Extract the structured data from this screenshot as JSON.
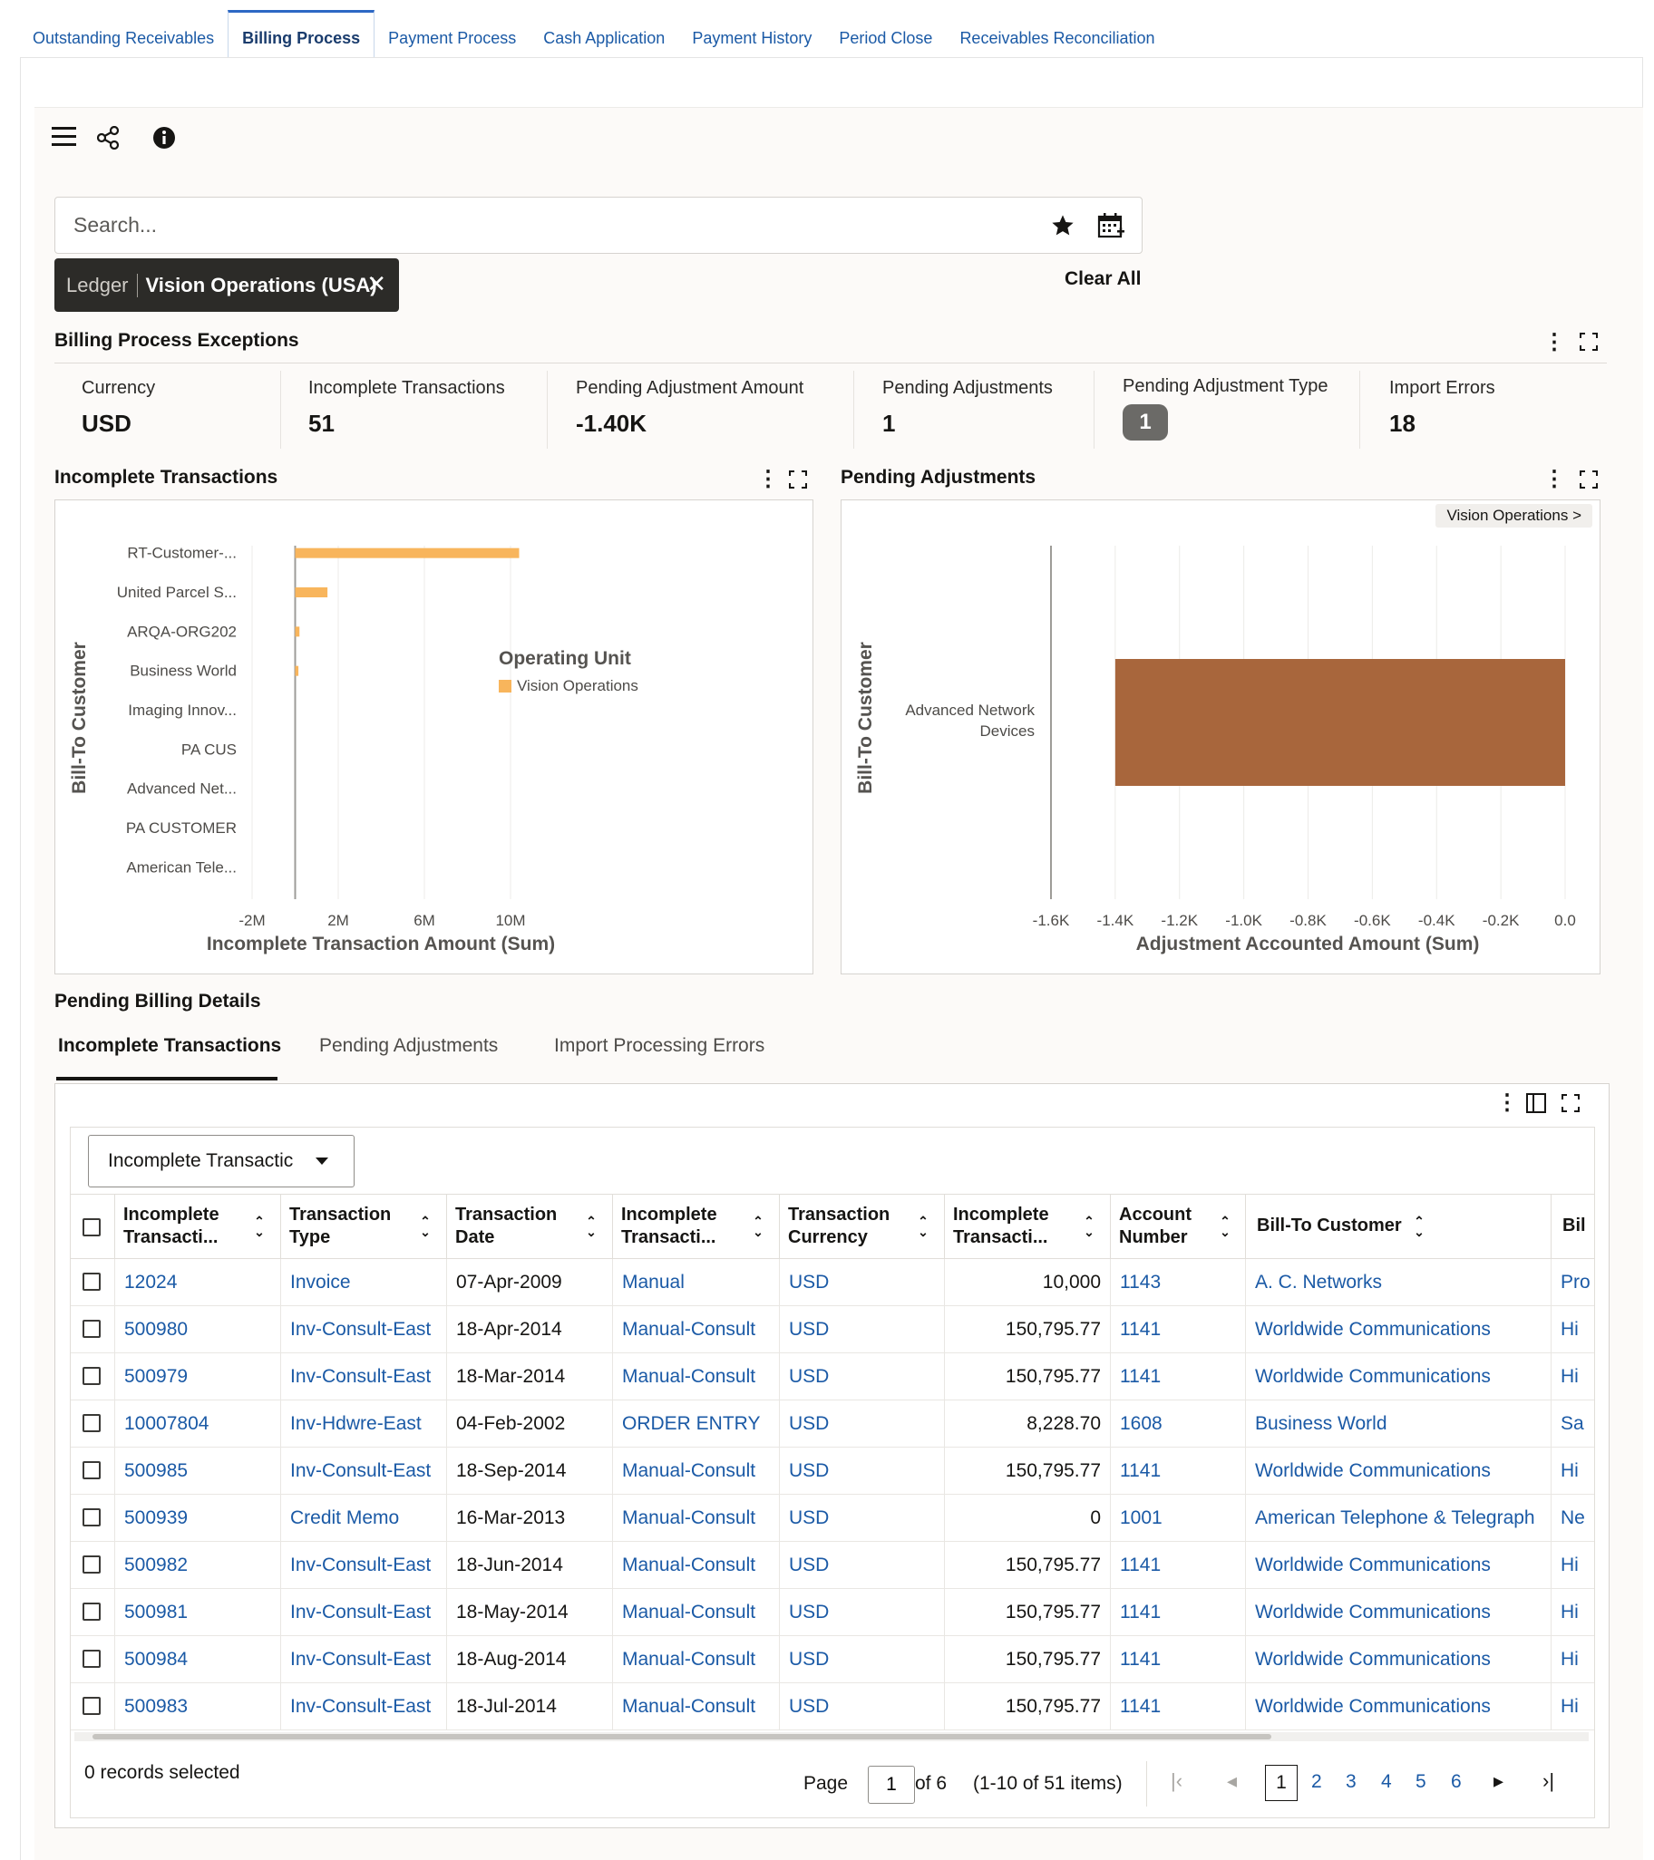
{
  "top_tabs": [
    {
      "label": "Outstanding Receivables"
    },
    {
      "label": "Billing Process"
    },
    {
      "label": "Payment Process"
    },
    {
      "label": "Cash Application"
    },
    {
      "label": "Payment History"
    },
    {
      "label": "Period Close"
    },
    {
      "label": "Receivables Reconciliation"
    }
  ],
  "active_tab": "Billing Process",
  "toolbar": {
    "menu_icon": "hamburger-icon",
    "share_icon": "share-icon",
    "info_icon": "info-icon"
  },
  "search": {
    "placeholder": "Search...",
    "value": "",
    "star_icon": "star-icon",
    "calendar_icon": "calendar-icon"
  },
  "filter_chip": {
    "label": "Ledger",
    "value": "Vision Operations (USA)"
  },
  "clear_all": "Clear All",
  "exceptions": {
    "title": "Billing Process Exceptions",
    "metrics": [
      {
        "label": "Currency",
        "value": "USD"
      },
      {
        "label": "Incomplete Transactions",
        "value": "51"
      },
      {
        "label": "Pending Adjustment Amount",
        "value": "-1.40K"
      },
      {
        "label": "Pending Adjustments",
        "value": "1"
      },
      {
        "label": "Pending Adjustment Type",
        "value": "1"
      },
      {
        "label": "Import Errors",
        "value": "18"
      }
    ]
  },
  "chart_incomplete": {
    "title": "Incomplete Transactions",
    "chart_data": {
      "type": "bar",
      "orientation": "horizontal",
      "categories": [
        "RT-Customer-...",
        "United Parcel S...",
        "ARQA-ORG202",
        "Business World",
        "Imaging Innov...",
        "PA CUS",
        "Advanced Net...",
        "PA CUSTOMER",
        "American Tele..."
      ],
      "series": [
        {
          "name": "Vision Operations",
          "values": [
            10400000,
            1500000,
            200000,
            150000,
            0,
            0,
            0,
            0,
            0
          ]
        }
      ],
      "x_ticks": [
        "-2M",
        "2M",
        "6M",
        "10M"
      ],
      "x_tick_values": [
        -2000000,
        2000000,
        6000000,
        10000000
      ],
      "xlim": [
        -2000000,
        14000000
      ],
      "xlabel": "Incomplete Transaction Amount (Sum)",
      "ylabel": "Bill-To Customer",
      "legend_title": "Operating Unit",
      "legend_position": "right",
      "color": "#f8b55c"
    }
  },
  "chart_pending": {
    "title": "Pending Adjustments",
    "breadcrumb": "Vision Operations >",
    "chart_data": {
      "type": "bar",
      "orientation": "horizontal",
      "categories": [
        "Advanced Network Devices"
      ],
      "category_lines": [
        "Advanced Network",
        "Devices"
      ],
      "series": [
        {
          "values": [
            -1400
          ]
        }
      ],
      "x_ticks": [
        "-1.6K",
        "-1.4K",
        "-1.2K",
        "-1.0K",
        "-0.8K",
        "-0.6K",
        "-0.4K",
        "-0.2K",
        "0.0"
      ],
      "x_tick_values": [
        -1600,
        -1400,
        -1200,
        -1000,
        -800,
        -600,
        -400,
        -200,
        0
      ],
      "xlim": [
        -1600,
        0
      ],
      "xlabel": "Adjustment Accounted Amount (Sum)",
      "ylabel": "Bill-To Customer",
      "color": "#a8663c"
    }
  },
  "details": {
    "title": "Pending Billing Details",
    "tabs": [
      {
        "label": "Incomplete Transactions"
      },
      {
        "label": "Pending Adjustments"
      },
      {
        "label": "Import Processing Errors"
      }
    ],
    "view_select": "Incomplete Transactic",
    "columns": [
      {
        "line1": "Incomplete",
        "line2": "Transacti..."
      },
      {
        "line1": "Transaction",
        "line2": "Type"
      },
      {
        "line1": "Transaction",
        "line2": "Date"
      },
      {
        "line1": "Incomplete",
        "line2": "Transacti..."
      },
      {
        "line1": "Transaction",
        "line2": "Currency"
      },
      {
        "line1": "Incomplete",
        "line2": "Transacti..."
      },
      {
        "line1": "Account",
        "line2": "Number"
      },
      {
        "line1": "Bill-To Customer",
        "line2": ""
      },
      {
        "line1": "Bil",
        "line2": ""
      }
    ],
    "rows": [
      [
        "12024",
        "Invoice",
        "07-Apr-2009",
        "Manual",
        "USD",
        "10,000",
        "1143",
        "A. C. Networks",
        "Pro"
      ],
      [
        "500980",
        "Inv-Consult-East",
        "18-Apr-2014",
        "Manual-Consult",
        "USD",
        "150,795.77",
        "1141",
        "Worldwide Communications",
        "Hi"
      ],
      [
        "500979",
        "Inv-Consult-East",
        "18-Mar-2014",
        "Manual-Consult",
        "USD",
        "150,795.77",
        "1141",
        "Worldwide Communications",
        "Hi"
      ],
      [
        "10007804",
        "Inv-Hdwre-East",
        "04-Feb-2002",
        "ORDER ENTRY",
        "USD",
        "8,228.70",
        "1608",
        "Business World",
        "Sa"
      ],
      [
        "500985",
        "Inv-Consult-East",
        "18-Sep-2014",
        "Manual-Consult",
        "USD",
        "150,795.77",
        "1141",
        "Worldwide Communications",
        "Hi"
      ],
      [
        "500939",
        "Credit Memo",
        "16-Mar-2013",
        "Manual-Consult",
        "USD",
        "0",
        "1001",
        "American Telephone & Telegraph",
        "Ne"
      ],
      [
        "500982",
        "Inv-Consult-East",
        "18-Jun-2014",
        "Manual-Consult",
        "USD",
        "150,795.77",
        "1141",
        "Worldwide Communications",
        "Hi"
      ],
      [
        "500981",
        "Inv-Consult-East",
        "18-May-2014",
        "Manual-Consult",
        "USD",
        "150,795.77",
        "1141",
        "Worldwide Communications",
        "Hi"
      ],
      [
        "500984",
        "Inv-Consult-East",
        "18-Aug-2014",
        "Manual-Consult",
        "USD",
        "150,795.77",
        "1141",
        "Worldwide Communications",
        "Hi"
      ],
      [
        "500983",
        "Inv-Consult-East",
        "18-Jul-2014",
        "Manual-Consult",
        "USD",
        "150,795.77",
        "1141",
        "Worldwide Communications",
        "Hi"
      ]
    ],
    "footer": {
      "selected": "0 records selected",
      "page_label": "Page",
      "page_value": "1",
      "of_pages": "of 6",
      "range": "(1-10 of 51 items)",
      "pages": [
        "1",
        "2",
        "3",
        "4",
        "5",
        "6"
      ]
    }
  }
}
